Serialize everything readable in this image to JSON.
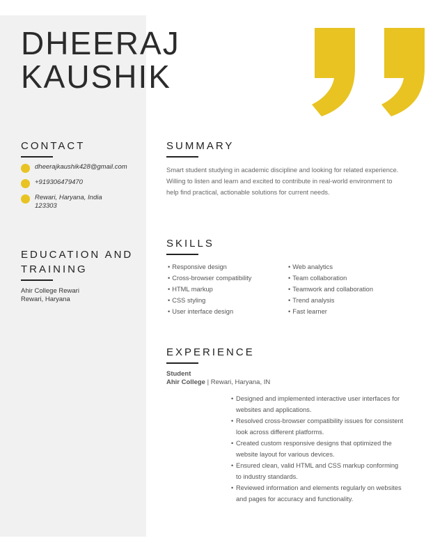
{
  "name": {
    "first": "DHEERAJ",
    "last": "KAUSHIK"
  },
  "colors": {
    "accent": "#e8c322",
    "sidebar": "#f1f1f1"
  },
  "contact": {
    "heading": "CONTACT",
    "email": "dheerajkaushik428@gmail.com",
    "phone": "+919306479470",
    "address_line1": "Rewari, Haryana, India",
    "address_line2": "123303"
  },
  "education": {
    "heading_line1": "EDUCATION AND",
    "heading_line2": "TRAINING",
    "school": "Ahir College Rewari",
    "location": "Rewari, Haryana"
  },
  "summary": {
    "heading": "SUMMARY",
    "text": "Smart student studying in academic discipline and looking for related experience. Willing to listen and learn and excited to contribute in real-world environment to help find practical, actionable solutions for current needs."
  },
  "skills": {
    "heading": "SKILLS",
    "col1": [
      "Responsive design",
      "Cross-browser compatibility",
      "HTML markup",
      "CSS styling",
      "User interface design"
    ],
    "col2": [
      "Web analytics",
      "Team collaboration",
      "Teamwork and collaboration",
      "Trend analysis",
      "Fast learner"
    ]
  },
  "experience": {
    "heading": "EXPERIENCE",
    "title": "Student",
    "company": "Ahir College",
    "separator": "|",
    "location": "Rewari, Haryana, IN",
    "bullets": [
      "Designed and implemented interactive user interfaces for websites and applications.",
      "Resolved cross-browser compatibility issues for consistent look across different platforms.",
      "Created custom responsive designs that optimized the website layout for various devices.",
      "Ensured clean, valid HTML and CSS markup conforming to industry standards.",
      "Reviewed information and elements regularly on websites and pages for accuracy and functionality."
    ]
  }
}
